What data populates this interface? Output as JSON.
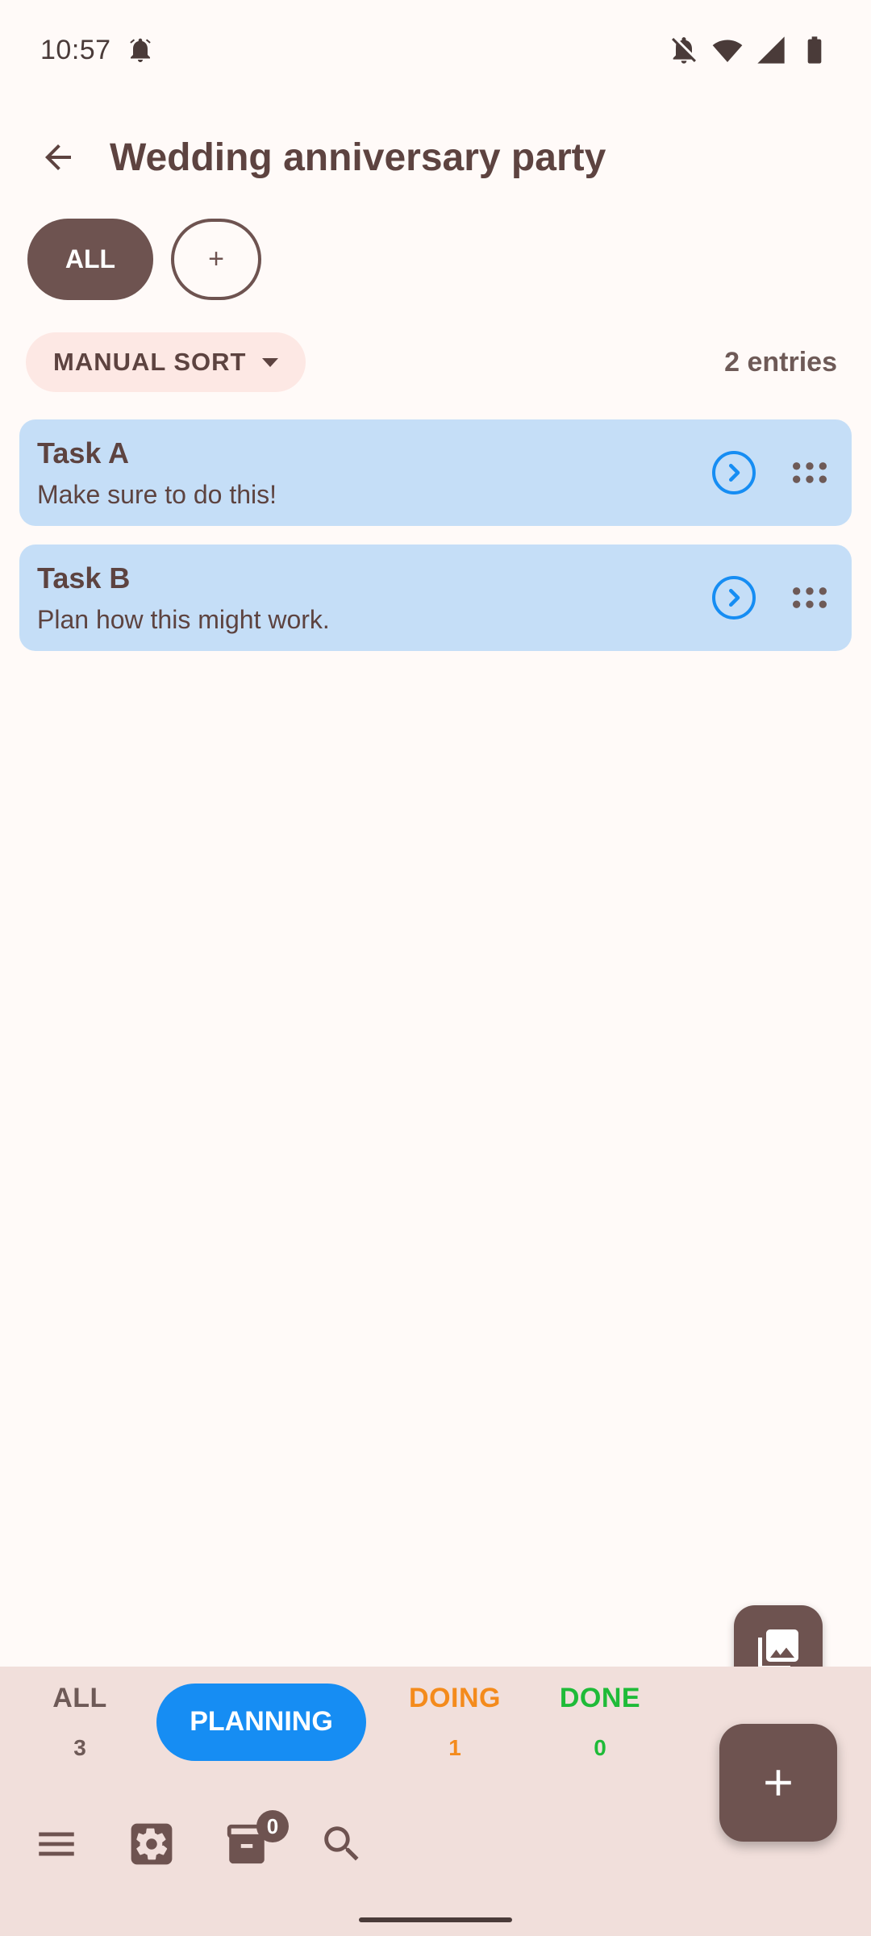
{
  "status_bar": {
    "time": "10:57",
    "icons": [
      "alarm-icon",
      "notifications-off-icon",
      "wifi-icon",
      "cell-signal-icon",
      "battery-icon"
    ]
  },
  "app_bar": {
    "title": "Wedding anniversary party",
    "back_icon": "arrow-back-icon"
  },
  "chips": {
    "all_label": "ALL",
    "add_label": "+"
  },
  "sort": {
    "label": "MANUAL SORT",
    "entries": "2 entries"
  },
  "tasks": [
    {
      "title": "Task A",
      "description": "Make sure to do this!"
    },
    {
      "title": "Task B",
      "description": "Plan how this might work."
    }
  ],
  "status_tabs": {
    "all": {
      "label": "ALL",
      "count": "3"
    },
    "planning": {
      "label": "PLANNING"
    },
    "doing": {
      "label": "DOING",
      "count": "1"
    },
    "done": {
      "label": "DONE",
      "count": "0"
    }
  },
  "bottom_bar": {
    "inbox_badge": "0",
    "icons": [
      "menu-icon",
      "settings-icon",
      "inbox-icon",
      "search-icon"
    ]
  },
  "colors": {
    "accent": "#6e5350",
    "card": "#c5def7",
    "planning": "#168df3",
    "doing": "#f48b1c",
    "done": "#1fbb38",
    "panel": "#f1dfdb"
  }
}
